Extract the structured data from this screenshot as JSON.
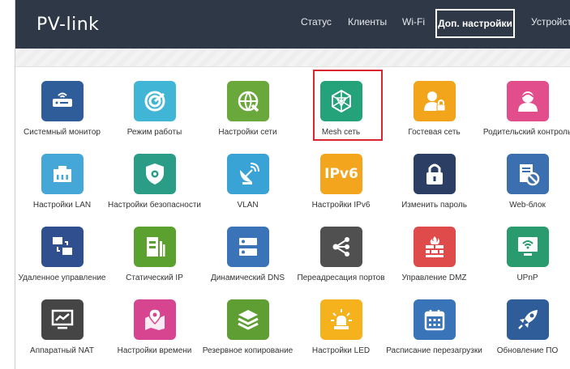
{
  "app": {
    "logo": "PV-link"
  },
  "nav": {
    "status": "Статус",
    "clients": "Клиенты",
    "wifi": "Wi-Fi",
    "advanced": "Доп. настройки",
    "device": "Устройство"
  },
  "tiles": [
    {
      "label": "Системный монитор",
      "color": "#2f5d9a",
      "icon": "router-monitor-icon"
    },
    {
      "label": "Режим работы",
      "color": "#41b5d6",
      "icon": "radar-mode-icon"
    },
    {
      "label": "Настройки сети",
      "color": "#6aa83c",
      "icon": "globe-wrench-icon"
    },
    {
      "label": "Mesh сеть",
      "color": "#24a37a",
      "icon": "mesh-network-icon"
    },
    {
      "label": "Гостевая сеть",
      "color": "#f2a51a",
      "icon": "guest-lock-icon"
    },
    {
      "label": "Родительский контроль",
      "color": "#e24d8c",
      "icon": "parent-user-icon"
    },
    {
      "label": "Настройки LAN",
      "color": "#45a7d8",
      "icon": "lan-port-icon"
    },
    {
      "label": "Настройки безопасности",
      "color": "#2b9c85",
      "icon": "shield-gear-icon"
    },
    {
      "label": "VLAN",
      "color": "#3aa3d6",
      "icon": "satellite-dish-icon"
    },
    {
      "label": "Настройки IPv6",
      "color": "#f3a51d",
      "icon": "ipv6-icon",
      "text": "IPv6"
    },
    {
      "label": "Изменить пароль",
      "color": "#2c3e63",
      "icon": "padlock-icon"
    },
    {
      "label": "Web-блок",
      "color": "#3b6fb0",
      "icon": "web-block-icon"
    },
    {
      "label": "Удаленное управление",
      "color": "#2f4f8f",
      "icon": "remote-desktop-icon"
    },
    {
      "label": "Статический IP",
      "color": "#5aa130",
      "icon": "server-doc-icon"
    },
    {
      "label": "Динамический DNS",
      "color": "#3b73b8",
      "icon": "dns-server-icon"
    },
    {
      "label": "Переадресация портов",
      "color": "#505050",
      "icon": "share-forward-icon"
    },
    {
      "label": "Управление DMZ",
      "color": "#df4b4b",
      "icon": "firewall-icon"
    },
    {
      "label": "UPnP",
      "color": "#2a9a6f",
      "icon": "wifi-monitor-icon"
    },
    {
      "label": "Аппаратный NAT",
      "color": "#454545",
      "icon": "chart-monitor-icon"
    },
    {
      "label": "Настройки времени",
      "color": "#d7448f",
      "icon": "map-pin-icon"
    },
    {
      "label": "Резервное копирование",
      "color": "#5f9e33",
      "icon": "layers-backup-icon"
    },
    {
      "label": "Настройки LED",
      "color": "#f5b21c",
      "icon": "led-light-icon"
    },
    {
      "label": "Расписание перезагрузки",
      "color": "#3a74b8",
      "icon": "calendar-icon"
    },
    {
      "label": "Обновление ПО",
      "color": "#2f5d9a",
      "icon": "rocket-update-icon"
    }
  ]
}
